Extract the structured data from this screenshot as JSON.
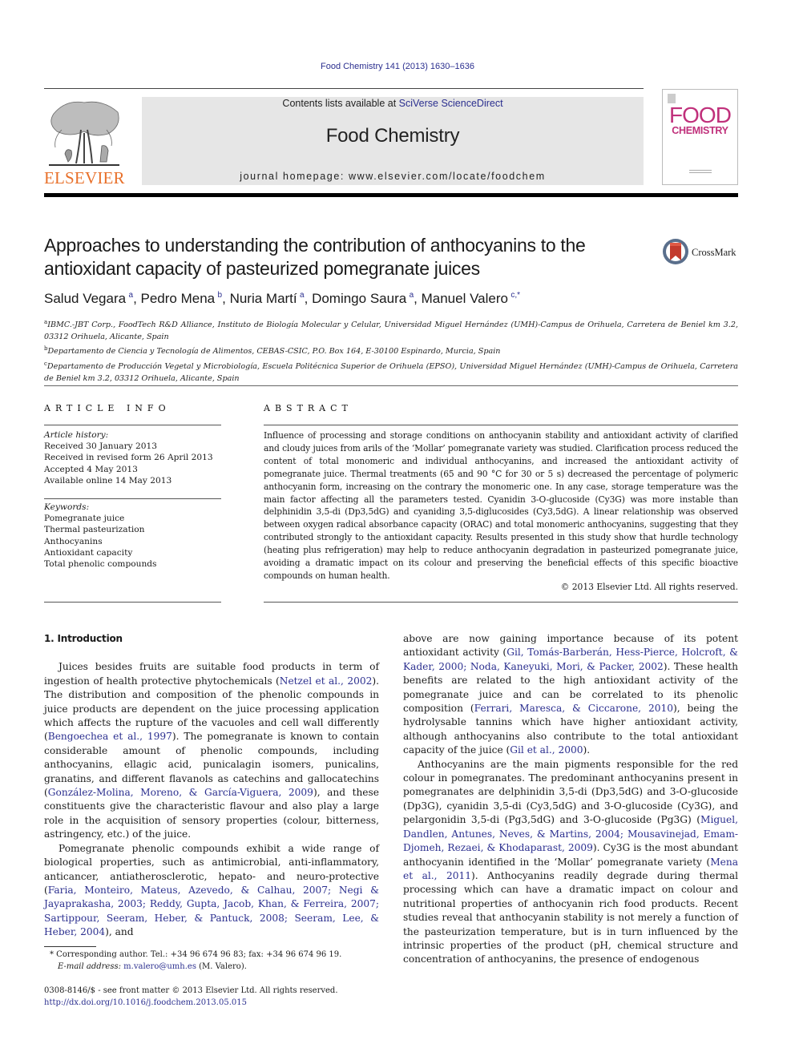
{
  "running_header": "Food Chemistry 141 (2013) 1630–1636",
  "masthead": {
    "publisher_logo": "ELSEVIER",
    "contents_prefix": "Contents lists available at ",
    "contents_link": "SciVerse ScienceDirect",
    "journal_title": "Food Chemistry",
    "homepage": "journal homepage: www.elsevier.com/locate/foodchem",
    "cover": {
      "line1": "FOOD",
      "line2": "CHEMISTRY"
    },
    "colors": {
      "elsevier_orange": "#e8702a",
      "cover_magenta": "#c0307b",
      "link_blue": "#2b2f8f"
    }
  },
  "article": {
    "title": "Approaches to understanding the contribution of anthocyanins to the antioxidant capacity of pasteurized pomegranate juices",
    "crossmark_label": "CrossMark",
    "authors": [
      {
        "name": "Salud Vegara",
        "aff": "a"
      },
      {
        "name": "Pedro Mena",
        "aff": "b"
      },
      {
        "name": "Nuria Martí",
        "aff": "a"
      },
      {
        "name": "Domingo Saura",
        "aff": "a"
      },
      {
        "name": "Manuel Valero",
        "aff": "c,*"
      }
    ],
    "affiliations": [
      {
        "key": "a",
        "text": "IBMC.-JBT Corp., FoodTech R&D Alliance, Instituto de Biología Molecular y Celular, Universidad Miguel Hernández (UMH)-Campus de Orihuela, Carretera de Beniel km 3.2, 03312 Orihuela, Alicante, Spain"
      },
      {
        "key": "b",
        "text": "Departamento de Ciencia y Tecnología de Alimentos, CEBAS-CSIC, P.O. Box 164, E-30100 Espinardo, Murcia, Spain"
      },
      {
        "key": "c",
        "text": "Departamento de Producción Vegetal y Microbiología, Escuela Politécnica Superior de Orihuela (EPSO), Universidad Miguel Hernández (UMH)-Campus de Orihuela, Carretera de Beniel km 3.2, 03312 Orihuela, Alicante, Spain"
      }
    ]
  },
  "article_info": {
    "heading": "ARTICLE INFO",
    "history_label": "Article history:",
    "history": [
      "Received 30 January 2013",
      "Received in revised form 26 April 2013",
      "Accepted 4 May 2013",
      "Available online 14 May 2013"
    ],
    "keywords_label": "Keywords:",
    "keywords": [
      "Pomegranate juice",
      "Thermal pasteurization",
      "Anthocyanins",
      "Antioxidant capacity",
      "Total phenolic compounds"
    ]
  },
  "abstract": {
    "heading": "ABSTRACT",
    "text": "Influence of processing and storage conditions on anthocyanin stability and antioxidant activity of clarified and cloudy juices from arils of the ‘Mollar’ pomegranate variety was studied. Clarification process reduced the content of total monomeric and individual anthocyanins, and increased the antioxidant activity of pomegranate juice. Thermal treatments (65 and 90 °C for 30 or 5 s) decreased the percentage of polymeric anthocyanin form, increasing on the contrary the monomeric one. In any case, storage temperature was the main factor affecting all the parameters tested. Cyanidin 3-O-glucoside (Cy3G) was more instable than delphinidin 3,5-di (Dp3,5dG) and cyaniding 3,5-diglucosides (Cy3,5dG). A linear relationship was observed between oxygen radical absorbance capacity (ORAC) and total monomeric anthocyanins, suggesting that they contributed strongly to the antioxidant capacity. Results presented in this study show that hurdle technology (heating plus refrigeration) may help to reduce anthocyanin degradation in pasteurized pomegranate juice, avoiding a dramatic impact on its colour and preserving the beneficial effects of this specific bioactive compounds on human health.",
    "copyright": "© 2013 Elsevier Ltd. All rights reserved."
  },
  "body": {
    "intro_heading": "1. Introduction",
    "left_paragraphs": [
      [
        {
          "t": "Juices besides fruits are suitable food products in term of ingestion of health protective phytochemicals ("
        },
        {
          "t": "Netzel et al., 2002",
          "link": true
        },
        {
          "t": "). The distribution and composition of the phenolic compounds in juice products are dependent on the juice processing application which affects the rupture of the vacuoles and cell wall differently ("
        },
        {
          "t": "Bengoechea et al., 1997",
          "link": true
        },
        {
          "t": "). The pomegranate is known to contain considerable amount of phenolic compounds, including anthocyanins, ellagic acid, punicalagin isomers, punicalins, granatins, and different flavanols as catechins and gallocatechins ("
        },
        {
          "t": "González-Molina, Moreno, & García-Viguera, 2009",
          "link": true
        },
        {
          "t": "), and these constituents give the characteristic flavour and also play a large role in the acquisition of sensory properties (colour, bitterness, astringency, etc.) of the juice."
        }
      ],
      [
        {
          "t": "Pomegranate phenolic compounds exhibit a wide range of biological properties, such as antimicrobial, anti-inflammatory, anticancer, antiatherosclerotic, hepato- and neuro-protective ("
        },
        {
          "t": "Faria, Monteiro, Mateus, Azevedo, & Calhau, 2007; Negi & Jayaprakasha, 2003; Reddy, Gupta, Jacob, Khan, & Ferreira, 2007; Sartippour, Seeram, Heber, & Pantuck, 2008; Seeram, Lee, & Heber, 2004",
          "link": true
        },
        {
          "t": "), and"
        }
      ]
    ],
    "right_paragraphs": [
      [
        {
          "t": "above are now gaining importance because of its potent antioxidant activity ("
        },
        {
          "t": "Gil, Tomás-Barberán, Hess-Pierce, Holcroft, & Kader, 2000; Noda, Kaneyuki, Mori, & Packer, 2002",
          "link": true
        },
        {
          "t": "). These health benefits are related to the high antioxidant activity of the pomegranate juice and can be correlated to its phenolic composition ("
        },
        {
          "t": "Ferrari, Maresca, & Ciccarone, 2010",
          "link": true
        },
        {
          "t": "), being the hydrolysable tannins which have higher antioxidant activity, although anthocyanins also contribute to the total antioxidant capacity of the juice ("
        },
        {
          "t": "Gil et al., 2000",
          "link": true
        },
        {
          "t": ")."
        }
      ],
      [
        {
          "t": "Anthocyanins are the main pigments responsible for the red colour in pomegranates. The predominant anthocyanins present in pomegranates are delphinidin 3,5-di (Dp3,5dG) and 3-O-glucoside (Dp3G), cyanidin 3,5-di (Cy3,5dG) and 3-O-glucoside (Cy3G), and pelargonidin 3,5-di (Pg3,5dG) and 3-O-glucoside (Pg3G) ("
        },
        {
          "t": "Miguel, Dandlen, Antunes, Neves, & Martins, 2004; Mousavinejad, Emam-Djomeh, Rezaei, & Khodaparast, 2009",
          "link": true
        },
        {
          "t": "). Cy3G is the most abundant anthocyanin identified in the ‘Mollar’ pomegranate variety ("
        },
        {
          "t": "Mena et al., 2011",
          "link": true
        },
        {
          "t": "). Anthocyanins readily degrade during thermal processing which can have a dramatic impact on colour and nutritional properties of anthocyanin rich food products. Recent studies reveal that anthocyanin stability is not merely a function of the pasteurization temperature, but is in turn influenced by the intrinsic properties of the product (pH, chemical structure and concentration of anthocyanins, the presence of endogenous"
        }
      ]
    ]
  },
  "footnotes": {
    "corresponding": "* Corresponding author. Tel.: +34 96 674 96 83; fax: +34 96 674 96 19.",
    "email_label": "E-mail address: ",
    "email": "m.valero@umh.es",
    "email_suffix": " (M. Valero).",
    "issn": "0308-8146/$ - see front matter © 2013 Elsevier Ltd. All rights reserved.",
    "doi": "http://dx.doi.org/10.1016/j.foodchem.2013.05.015"
  }
}
